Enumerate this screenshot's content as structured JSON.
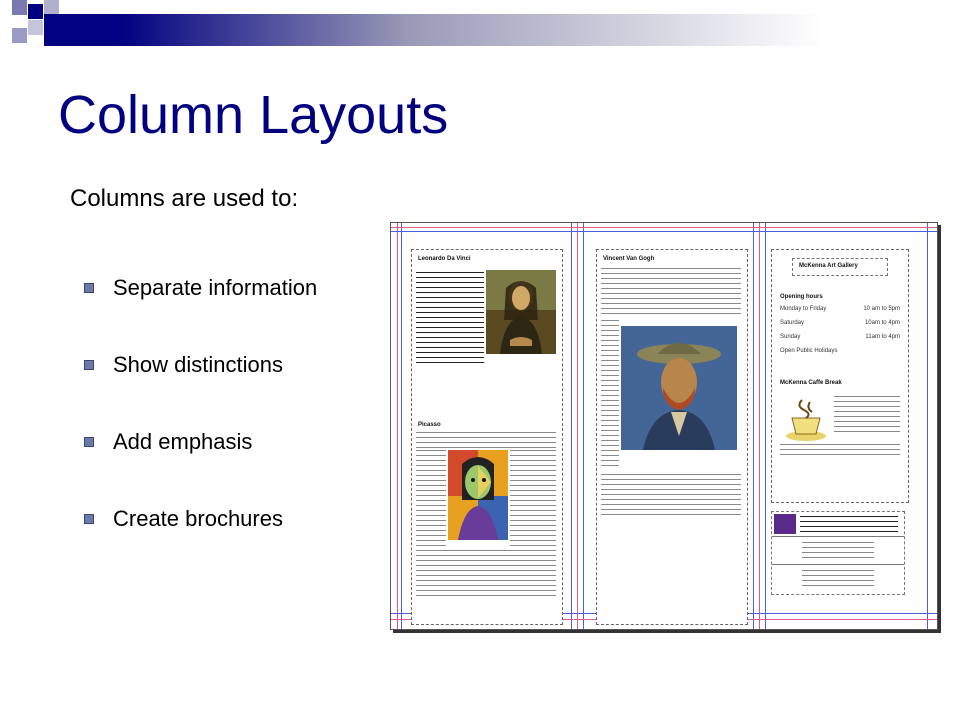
{
  "slide": {
    "title": "Column Layouts",
    "subtitle": "Columns are used to:",
    "bullets": [
      "Separate information",
      "Show distinctions",
      "Add emphasis",
      "Create brochures"
    ]
  },
  "colors": {
    "title": "#000080",
    "bullet": "#6b7aa8",
    "accent_dark": "#000080"
  },
  "brochure": {
    "panel1": {
      "heading": "Leonardo Da Vinci",
      "section": "Picasso"
    },
    "panel2": {
      "heading": "Vincent Van Gogh"
    },
    "panel3": {
      "heading": "McKenna Art Gallery",
      "hours_label": "Opening hours",
      "hours": [
        {
          "day": "Monday to Friday",
          "time": "10 am to 5pm"
        },
        {
          "day": "Saturday",
          "time": "10am to 4pm"
        },
        {
          "day": "Sunday",
          "time": "11am to 4pm"
        }
      ],
      "holidays": "Open Public Holidays",
      "coffee": "McKenna Caffe Break"
    }
  }
}
